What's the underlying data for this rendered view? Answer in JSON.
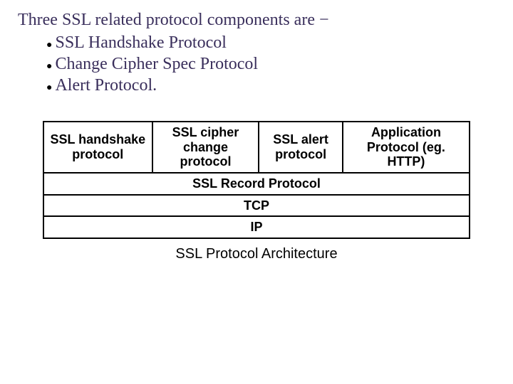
{
  "intro": "Three SSL related protocol components are −",
  "bullets": [
    "SSL Handshake Protocol",
    "Change Cipher Spec Protocol",
    "Alert Protocol."
  ],
  "table": {
    "top": [
      "SSL handshake protocol",
      "SSL cipher change protocol",
      "SSL alert protocol",
      "Application Protocol (eg. HTTP)"
    ],
    "rows": [
      "SSL Record Protocol",
      "TCP",
      "IP"
    ]
  },
  "caption": "SSL Protocol Architecture"
}
